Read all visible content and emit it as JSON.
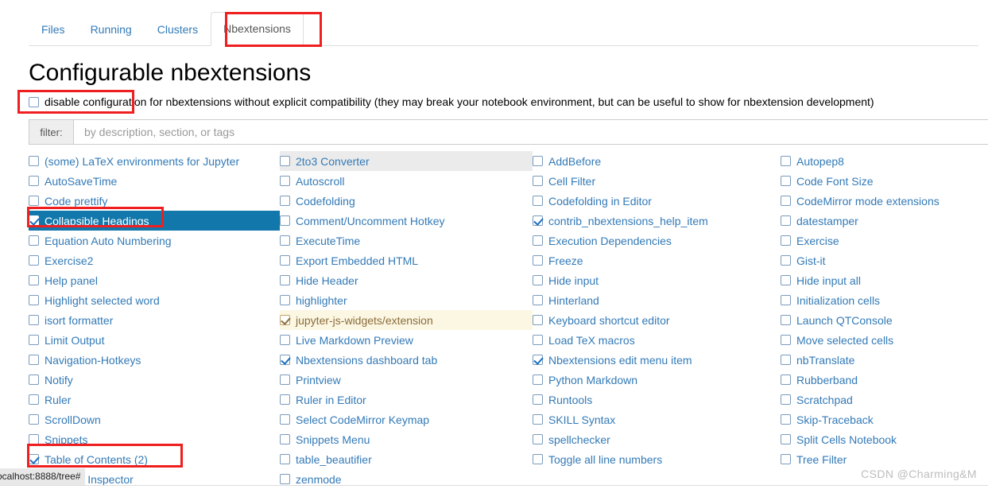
{
  "tabs": [
    {
      "label": "Files",
      "active": false
    },
    {
      "label": "Running",
      "active": false
    },
    {
      "label": "Clusters",
      "active": false
    },
    {
      "label": "Nbextensions",
      "active": true
    }
  ],
  "page_title": "Configurable nbextensions",
  "disable_config": {
    "checked": false,
    "label": "disable configuration for nbextensions without explicit compatibility (they may break your notebook environment, but can be useful to show for nbextension development)"
  },
  "filter": {
    "label": "filter:",
    "value": "",
    "placeholder": "by description, section, or tags"
  },
  "colors": {
    "link": "#337ab7",
    "selected_bg": "#1278ac",
    "hover_bg": "#ebebeb",
    "incompatible_bg": "#fcf7e3",
    "annotation": "#f01f1f"
  },
  "status_tooltip": "ocalhost:8888/tree#",
  "watermark": "CSDN @Charming&M",
  "columns": [
    {
      "items": [
        {
          "label": "(some) LaTeX environments for Jupyter",
          "checked": false,
          "state": "normal"
        },
        {
          "label": "AutoSaveTime",
          "checked": false,
          "state": "normal"
        },
        {
          "label": "Code prettify",
          "checked": false,
          "state": "normal"
        },
        {
          "label": "Collapsible Headings",
          "checked": true,
          "state": "selected"
        },
        {
          "label": "Equation Auto Numbering",
          "checked": false,
          "state": "normal"
        },
        {
          "label": "Exercise2",
          "checked": false,
          "state": "normal"
        },
        {
          "label": "Help panel",
          "checked": false,
          "state": "normal"
        },
        {
          "label": "Highlight selected word",
          "checked": false,
          "state": "normal"
        },
        {
          "label": "isort formatter",
          "checked": false,
          "state": "normal"
        },
        {
          "label": "Limit Output",
          "checked": false,
          "state": "normal"
        },
        {
          "label": "Navigation-Hotkeys",
          "checked": false,
          "state": "normal"
        },
        {
          "label": "Notify",
          "checked": false,
          "state": "normal"
        },
        {
          "label": "Ruler",
          "checked": false,
          "state": "normal"
        },
        {
          "label": "ScrollDown",
          "checked": false,
          "state": "normal"
        },
        {
          "label": "Snippets",
          "checked": false,
          "state": "normal"
        },
        {
          "label": "Table of Contents (2)",
          "checked": true,
          "state": "normal"
        },
        {
          "label": "Variable Inspector",
          "checked": false,
          "state": "normal"
        }
      ]
    },
    {
      "items": [
        {
          "label": "2to3 Converter",
          "checked": false,
          "state": "hover"
        },
        {
          "label": "Autoscroll",
          "checked": false,
          "state": "normal"
        },
        {
          "label": "Codefolding",
          "checked": false,
          "state": "normal"
        },
        {
          "label": "Comment/Uncomment Hotkey",
          "checked": false,
          "state": "normal"
        },
        {
          "label": "ExecuteTime",
          "checked": false,
          "state": "normal"
        },
        {
          "label": "Export Embedded HTML",
          "checked": false,
          "state": "normal"
        },
        {
          "label": "Hide Header",
          "checked": false,
          "state": "normal"
        },
        {
          "label": "highlighter",
          "checked": false,
          "state": "normal"
        },
        {
          "label": "jupyter-js-widgets/extension",
          "checked": true,
          "state": "incompatible"
        },
        {
          "label": "Live Markdown Preview",
          "checked": false,
          "state": "normal"
        },
        {
          "label": "Nbextensions dashboard tab",
          "checked": true,
          "state": "normal"
        },
        {
          "label": "Printview",
          "checked": false,
          "state": "normal"
        },
        {
          "label": "Ruler in Editor",
          "checked": false,
          "state": "normal"
        },
        {
          "label": "Select CodeMirror Keymap",
          "checked": false,
          "state": "normal"
        },
        {
          "label": "Snippets Menu",
          "checked": false,
          "state": "normal"
        },
        {
          "label": "table_beautifier",
          "checked": false,
          "state": "normal"
        },
        {
          "label": "zenmode",
          "checked": false,
          "state": "normal"
        }
      ]
    },
    {
      "items": [
        {
          "label": "AddBefore",
          "checked": false,
          "state": "normal"
        },
        {
          "label": "Cell Filter",
          "checked": false,
          "state": "normal"
        },
        {
          "label": "Codefolding in Editor",
          "checked": false,
          "state": "normal"
        },
        {
          "label": "contrib_nbextensions_help_item",
          "checked": true,
          "state": "normal"
        },
        {
          "label": "Execution Dependencies",
          "checked": false,
          "state": "normal"
        },
        {
          "label": "Freeze",
          "checked": false,
          "state": "normal"
        },
        {
          "label": "Hide input",
          "checked": false,
          "state": "normal"
        },
        {
          "label": "Hinterland",
          "checked": false,
          "state": "normal"
        },
        {
          "label": "Keyboard shortcut editor",
          "checked": false,
          "state": "normal"
        },
        {
          "label": "Load TeX macros",
          "checked": false,
          "state": "normal"
        },
        {
          "label": "Nbextensions edit menu item",
          "checked": true,
          "state": "normal"
        },
        {
          "label": "Python Markdown",
          "checked": false,
          "state": "normal"
        },
        {
          "label": "Runtools",
          "checked": false,
          "state": "normal"
        },
        {
          "label": "SKILL Syntax",
          "checked": false,
          "state": "normal"
        },
        {
          "label": "spellchecker",
          "checked": false,
          "state": "normal"
        },
        {
          "label": "Toggle all line numbers",
          "checked": false,
          "state": "normal"
        }
      ]
    },
    {
      "items": [
        {
          "label": "Autopep8",
          "checked": false,
          "state": "normal"
        },
        {
          "label": "Code Font Size",
          "checked": false,
          "state": "normal"
        },
        {
          "label": "CodeMirror mode extensions",
          "checked": false,
          "state": "normal"
        },
        {
          "label": "datestamper",
          "checked": false,
          "state": "normal"
        },
        {
          "label": "Exercise",
          "checked": false,
          "state": "normal"
        },
        {
          "label": "Gist-it",
          "checked": false,
          "state": "normal"
        },
        {
          "label": "Hide input all",
          "checked": false,
          "state": "normal"
        },
        {
          "label": "Initialization cells",
          "checked": false,
          "state": "normal"
        },
        {
          "label": "Launch QTConsole",
          "checked": false,
          "state": "normal"
        },
        {
          "label": "Move selected cells",
          "checked": false,
          "state": "normal"
        },
        {
          "label": "nbTranslate",
          "checked": false,
          "state": "normal"
        },
        {
          "label": "Rubberband",
          "checked": false,
          "state": "normal"
        },
        {
          "label": "Scratchpad",
          "checked": false,
          "state": "normal"
        },
        {
          "label": "Skip-Traceback",
          "checked": false,
          "state": "normal"
        },
        {
          "label": "Split Cells Notebook",
          "checked": false,
          "state": "normal"
        },
        {
          "label": "Tree Filter",
          "checked": false,
          "state": "normal"
        }
      ]
    }
  ]
}
